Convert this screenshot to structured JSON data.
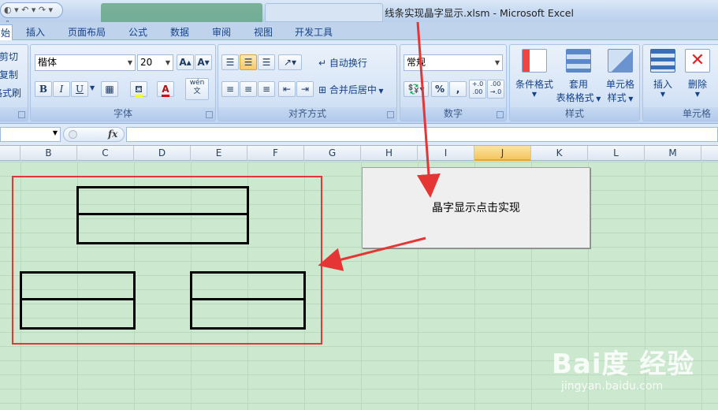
{
  "window": {
    "title": "线条实现晶字显示.xlsm - Microsoft Excel",
    "qat_glyphs": "◐ ▾  ↶ ▾  ↷ ▾  ⇩"
  },
  "ribbon_tabs": [
    "始",
    "插入",
    "页面布局",
    "公式",
    "数据",
    "审阅",
    "视图",
    "开发工具"
  ],
  "clipboard": {
    "cut": "剪切",
    "copy": "复制",
    "format_painter": "格式刷"
  },
  "font": {
    "name": "楷体",
    "size": "20",
    "grow": "A▴",
    "shrink": "A▾",
    "bold": "B",
    "italic": "I",
    "underline": "U",
    "font_color_glyph": "A",
    "phonetic": "wén\n文",
    "group_label": "字体"
  },
  "alignment": {
    "wrap_text": "自动换行",
    "merge_center": "合并后居中",
    "group_label": "对齐方式"
  },
  "number": {
    "format": "常规",
    "percent": "%",
    "comma": ",",
    "inc_decimal": "+.0\n.00",
    "dec_decimal": ".00\n→.0",
    "group_label": "数字"
  },
  "styles": {
    "conditional": "条件格式",
    "table_format_1": "套用",
    "table_format_2": "表格格式",
    "cell_style_1": "单元格",
    "cell_style_2": "样式",
    "group_label": "样式"
  },
  "cells": {
    "insert": "插入",
    "delete": "删除",
    "group_label": "单元格"
  },
  "formula_bar": {
    "name_box": "",
    "fx": "fx",
    "content": ""
  },
  "columns": [
    "B",
    "C",
    "D",
    "E",
    "F",
    "G",
    "H",
    "I",
    "J",
    "K",
    "L",
    "M"
  ],
  "active_column": "J",
  "macro_button": {
    "label": "晶字显示点击实现"
  },
  "watermark": {
    "logo": "Bai度 经验",
    "url": "jingyan.baidu.com"
  },
  "colors": {
    "annotation_red": "#e53535",
    "sheet_green": "#cce8cf",
    "active_column": "#f5c65f"
  }
}
